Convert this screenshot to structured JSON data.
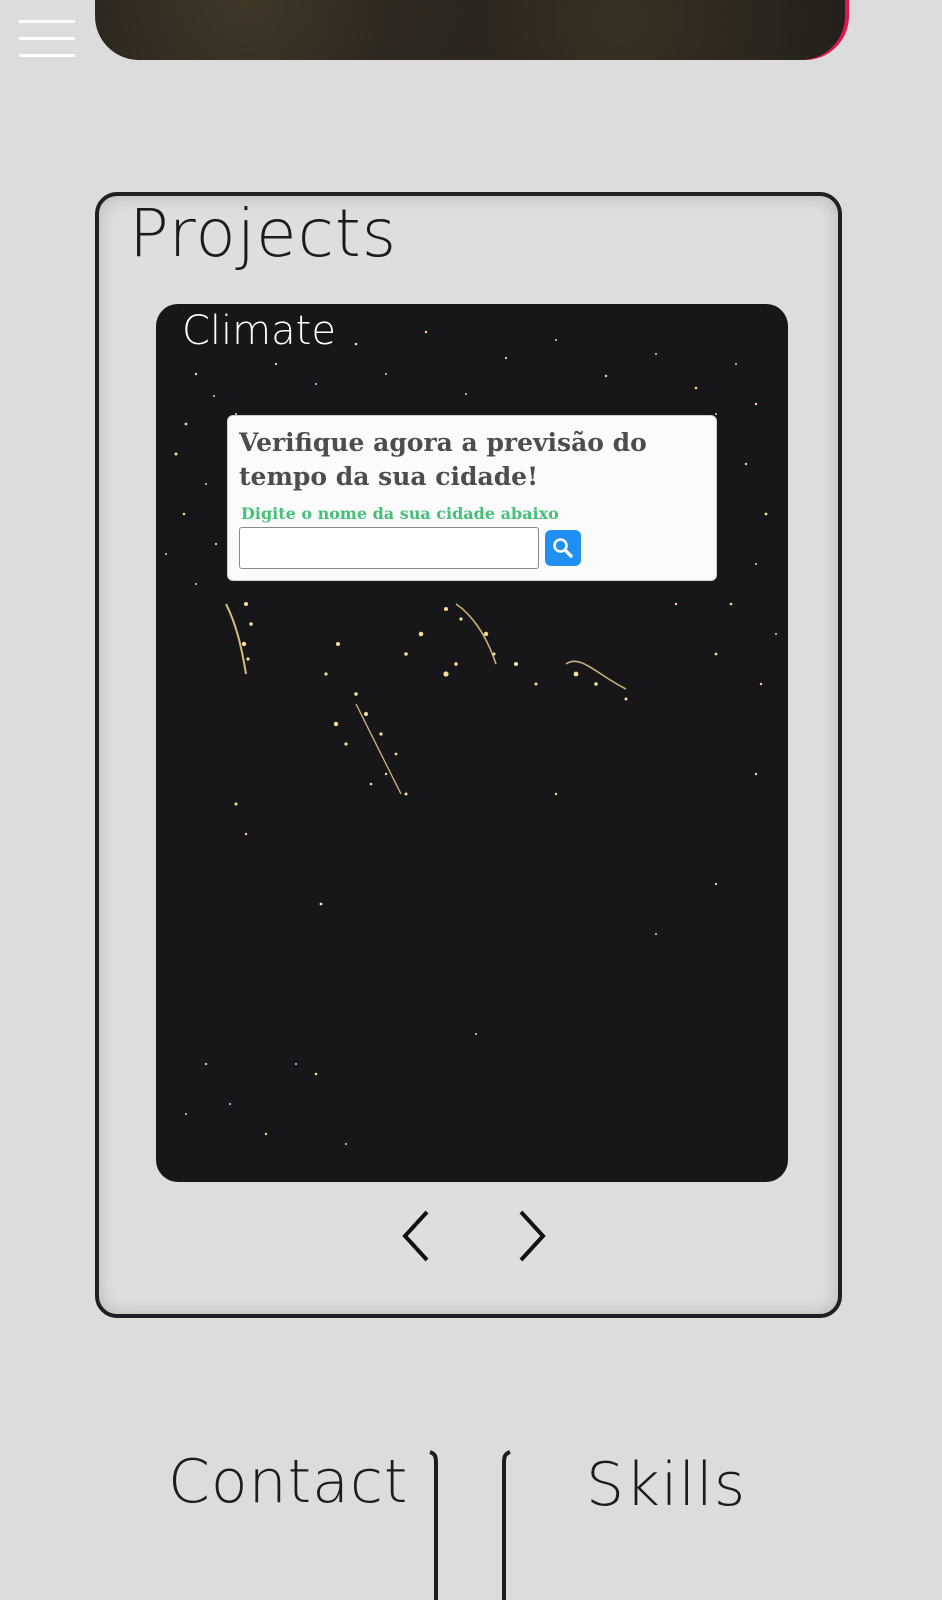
{
  "header": {
    "menu_icon": "hamburger-menu-icon",
    "accent_color": "#e0164f"
  },
  "projects": {
    "title": "Projects",
    "current_project": {
      "name": "Climate",
      "widget": {
        "heading": "Verifique agora a previsão do tempo da sua cidade!",
        "hint": "Digite o nome da sua cidade abaixo",
        "input_value": "",
        "search_icon": "search-icon",
        "hint_color": "#44c078",
        "button_color": "#1f8ff1"
      }
    },
    "prev_icon": "chevron-left-icon",
    "next_icon": "chevron-right-icon"
  },
  "bottom_nav": {
    "contact_label": "Contact",
    "skills_label": "Skills"
  }
}
